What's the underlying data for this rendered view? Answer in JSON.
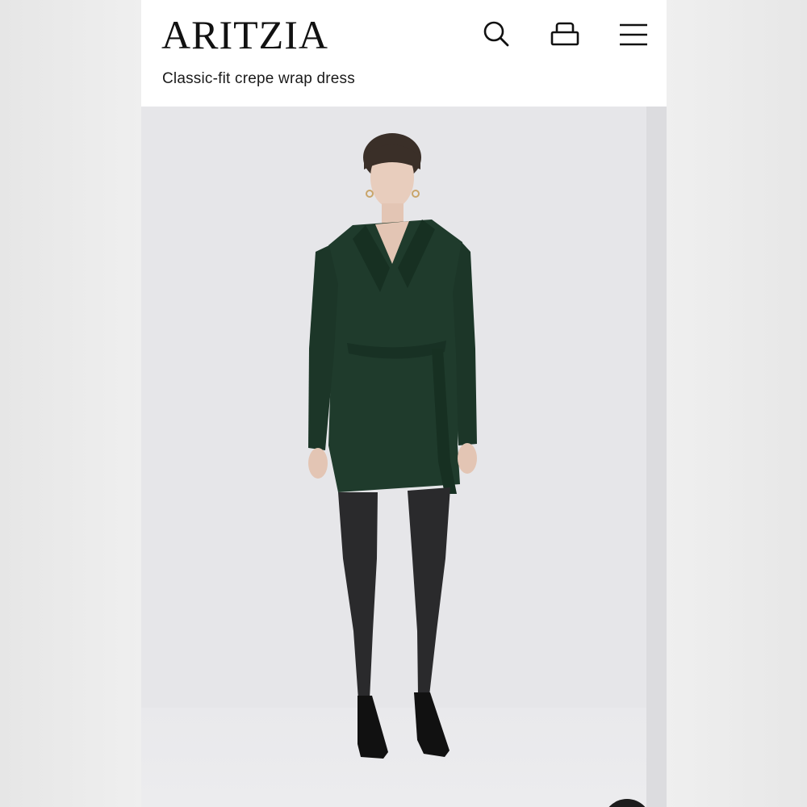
{
  "header": {
    "brand": "ARITZIA",
    "product_title": "Classic-fit crepe wrap dress"
  },
  "icons": {
    "search": "search-icon",
    "bag": "shopping-bag-icon",
    "menu": "hamburger-menu-icon"
  },
  "product_image": {
    "subject": "model wearing dark green wrap dress",
    "dress_color": "#1f3b2c"
  }
}
